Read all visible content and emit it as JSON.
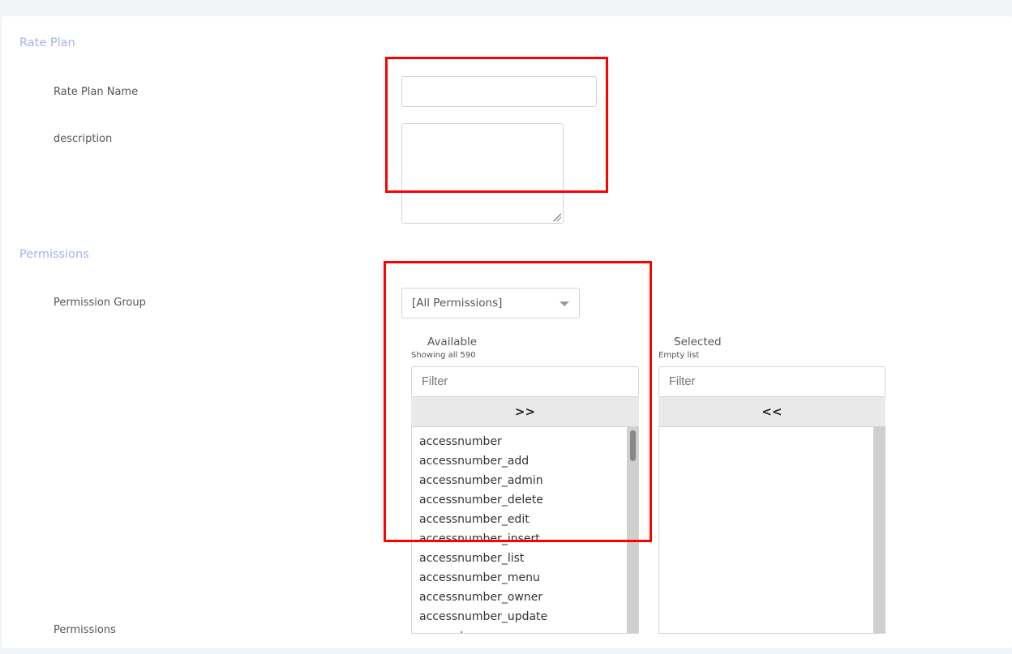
{
  "rate_plan": {
    "section_title": "Rate Plan",
    "name_label": "Rate Plan Name",
    "name_value": "",
    "description_label": "description",
    "description_value": ""
  },
  "permissions": {
    "section_title": "Permissions",
    "group_label": "Permission Group",
    "group_value": "[All Permissions]",
    "permissions_label": "Permissions",
    "available": {
      "title": "Available",
      "info": "Showing all 590",
      "filter_placeholder": "Filter",
      "move_all": ">>",
      "items": [
        "accessnumber",
        "accessnumber_add",
        "accessnumber_admin",
        "accessnumber_delete",
        "accessnumber_edit",
        "accessnumber_insert",
        "accessnumber_list",
        "accessnumber_menu",
        "accessnumber_owner",
        "accessnumber_update",
        "account"
      ]
    },
    "selected": {
      "title": "Selected",
      "info": "Empty list",
      "filter_placeholder": "Filter",
      "remove_all": "<<",
      "items": []
    }
  },
  "annotation_color": "#ff0000"
}
